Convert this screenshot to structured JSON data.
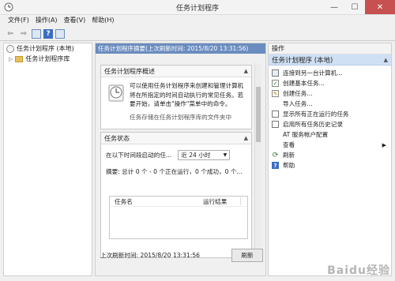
{
  "window": {
    "title": "任务计划程序",
    "controls": {
      "minimize": "—",
      "maximize": "☐",
      "close": "✕"
    }
  },
  "menu": [
    "文件(F)",
    "操作(A)",
    "查看(V)",
    "帮助(H)"
  ],
  "toolbar": {
    "back": "⇦",
    "forward": "⇨",
    "help": "?"
  },
  "tree": {
    "root": "任务计划程序 (本地)",
    "child": "任务计划程序库"
  },
  "center": {
    "header": "任务计划程序摘要(上次刷新时间: 2015/8/20 13:31:56)",
    "overview": {
      "title": "任务计划程序概述",
      "text": "可以使用任务计划程序来创建和管理计算机将在所指定的时间自动执行的常见任务。若要开始，请单击\"操作\"菜单中的命令。",
      "text_more": "任务存储在任务计划程序库的文件夹中"
    },
    "status": {
      "title": "任务状态",
      "label": "在以下时间段启动的任...",
      "combo_value": "近 24 小时",
      "summary": "摘要: 总计 0 个 - 0 个正在运行，0 个成功，0 个...",
      "col_name": "任务名",
      "col_result": "运行结果"
    },
    "footer": {
      "last_refresh": "上次刷新时间: 2015/8/20 13:31:56",
      "refresh_button": "刷新"
    }
  },
  "actions": {
    "header": "操作",
    "group": "任务计划程序 (本地)",
    "items": [
      {
        "label": "连接到另一台计算机...",
        "icon": "computer-icon"
      },
      {
        "label": "创建基本任务...",
        "icon": "task-basic-icon"
      },
      {
        "label": "创建任务...",
        "icon": "task-create-icon"
      },
      {
        "label": "导入任务...",
        "icon": "import-icon"
      },
      {
        "label": "显示所有正在运行的任务",
        "icon": "running-tasks-icon"
      },
      {
        "label": "启用所有任务历史记录",
        "icon": "history-icon"
      },
      {
        "label": "AT 服务帐户配置",
        "icon": "blank-icon"
      },
      {
        "label": "查看",
        "icon": "view-icon"
      },
      {
        "label": "刷新",
        "icon": "refresh-icon"
      },
      {
        "label": "帮助",
        "icon": "help-icon"
      }
    ]
  },
  "watermark": "Baidu经验"
}
